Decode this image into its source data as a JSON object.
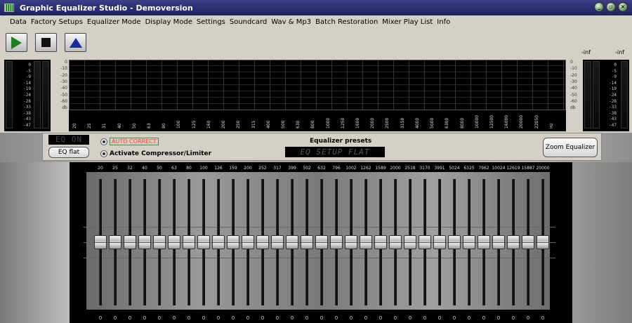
{
  "window": {
    "title": "Graphic Equalizer Studio - Demoversion",
    "buttons": [
      "minimize",
      "restore",
      "close"
    ]
  },
  "menu": [
    "Data",
    "Factory Setups",
    "Equalizer Mode",
    "Display Mode",
    "Settings",
    "Soundcard",
    "Wav & Mp3",
    "Batch Restoration",
    "Mixer Play List",
    "Info"
  ],
  "toolbar": {
    "play": "play-icon",
    "stop": "stop-icon",
    "eject": "eject-icon"
  },
  "vu": {
    "scale": [
      "0",
      "-5",
      "-9",
      "-14",
      "-19",
      "-24",
      "-28",
      "-33",
      "-38",
      "-43",
      "-47"
    ],
    "left_label": "-inf",
    "right_label": "-inf"
  },
  "analyzer": {
    "db_scale": [
      "0",
      "-10",
      "-20",
      "-30",
      "-40",
      "-50",
      "-60",
      "db"
    ],
    "freq_labels": [
      "20",
      "25",
      "31",
      "40",
      "50",
      "63",
      "80",
      "100",
      "125",
      "160",
      "200",
      "250",
      "315",
      "400",
      "500",
      "630",
      "800",
      "1000",
      "1250",
      "1600",
      "2000",
      "2500",
      "3150",
      "4000",
      "5000",
      "6300",
      "8000",
      "10000",
      "12500",
      "16000",
      "20000",
      "22050",
      "Hz"
    ]
  },
  "controls": {
    "eq_on": "EQ ON",
    "eq_flat": "EQ flat",
    "auto_correct": "AUTO CORRECT",
    "compressor": "Activate Compressor/Limiter",
    "presets_label": "Equalizer presets",
    "preset_display": "EQ SETUP FLAT",
    "zoom": "Zoom Equalizer"
  },
  "equalizer": {
    "bands": [
      "20",
      "25",
      "32",
      "40",
      "50",
      "63",
      "80",
      "100",
      "126",
      "159",
      "200",
      "252",
      "317",
      "399",
      "502",
      "632",
      "796",
      "1002",
      "1262",
      "1589",
      "2000",
      "2518",
      "3170",
      "3991",
      "5024",
      "6325",
      "7962",
      "10024",
      "12619",
      "15887",
      "20000"
    ],
    "values": [
      0,
      0,
      0,
      0,
      0,
      0,
      0,
      0,
      0,
      0,
      0,
      0,
      0,
      0,
      0,
      0,
      0,
      0,
      0,
      0,
      0,
      0,
      0,
      0,
      0,
      0,
      0,
      0,
      0,
      0,
      0
    ],
    "range": [
      -12,
      12
    ]
  },
  "colors": {
    "titlebar": "#2a2e72",
    "auto_correct_text": "#ff3a3a",
    "analyzer_bg": "#000000"
  }
}
